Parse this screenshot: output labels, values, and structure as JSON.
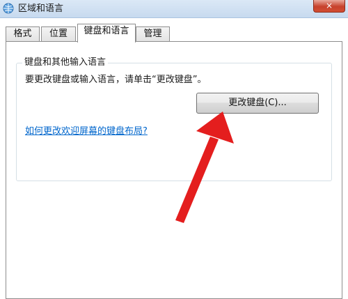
{
  "window": {
    "title": "区域和语言",
    "close_label": "×"
  },
  "tabs": [
    {
      "label": "格式"
    },
    {
      "label": "位置"
    },
    {
      "label": "键盘和语言"
    },
    {
      "label": "管理"
    }
  ],
  "group": {
    "legend": "键盘和其他输入语言",
    "instructions": "要更改键盘或输入语言，请单击“更改键盘”。",
    "change_button_label": "更改键盘(C)...",
    "welcome_link": "如何更改欢迎屏幕的键盘布局?"
  },
  "colors": {
    "accent": "#0066cc",
    "annotation_arrow": "#e41e1e"
  },
  "icons": {
    "app": "globe-keyboard-icon",
    "close": "close-icon",
    "annotation": "red-arrow-annotation"
  }
}
